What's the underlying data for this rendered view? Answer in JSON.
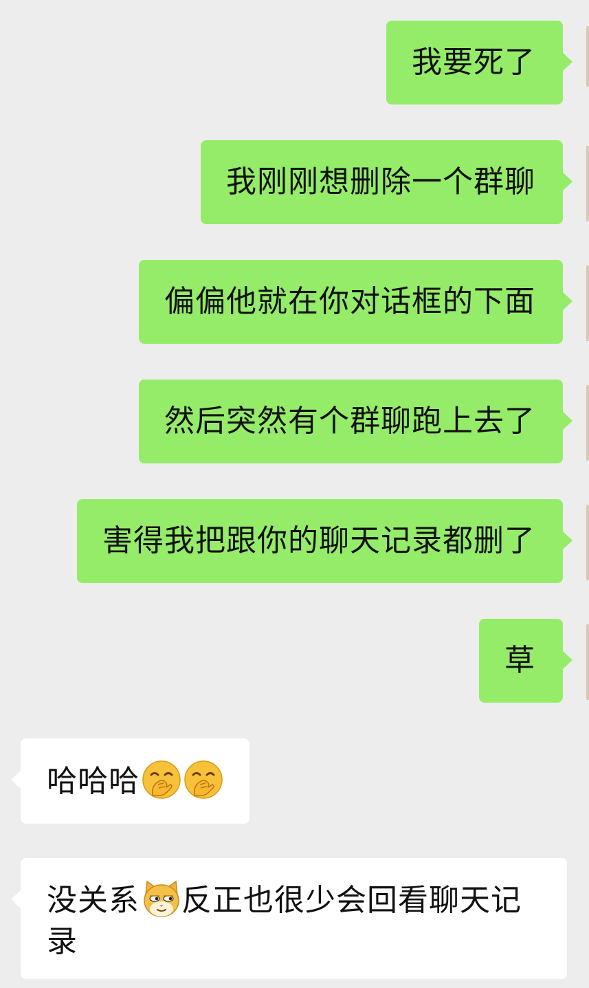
{
  "messages": [
    {
      "side": "sent",
      "text": "我要死了"
    },
    {
      "side": "sent",
      "text": "我刚刚想删除一个群聊"
    },
    {
      "side": "sent",
      "text": "偏偏他就在你对话框的下面"
    },
    {
      "side": "sent",
      "text": "然后突然有个群聊跑上去了"
    },
    {
      "side": "sent",
      "text": "害得我把跟你的聊天记录都删了"
    },
    {
      "side": "sent",
      "text": "草"
    },
    {
      "side": "received",
      "text": "哈哈哈",
      "emojis": [
        "hand-over-mouth-emoji",
        "hand-over-mouth-emoji"
      ]
    },
    {
      "side": "received",
      "text_before": "没关系",
      "emoji": "smirking-cat-emoji",
      "text_after": "反正也很少会回看聊天记录"
    }
  ],
  "colors": {
    "background": "#ededed",
    "sent_bubble": "#95ec69",
    "received_bubble": "#ffffff",
    "text": "#111111"
  }
}
